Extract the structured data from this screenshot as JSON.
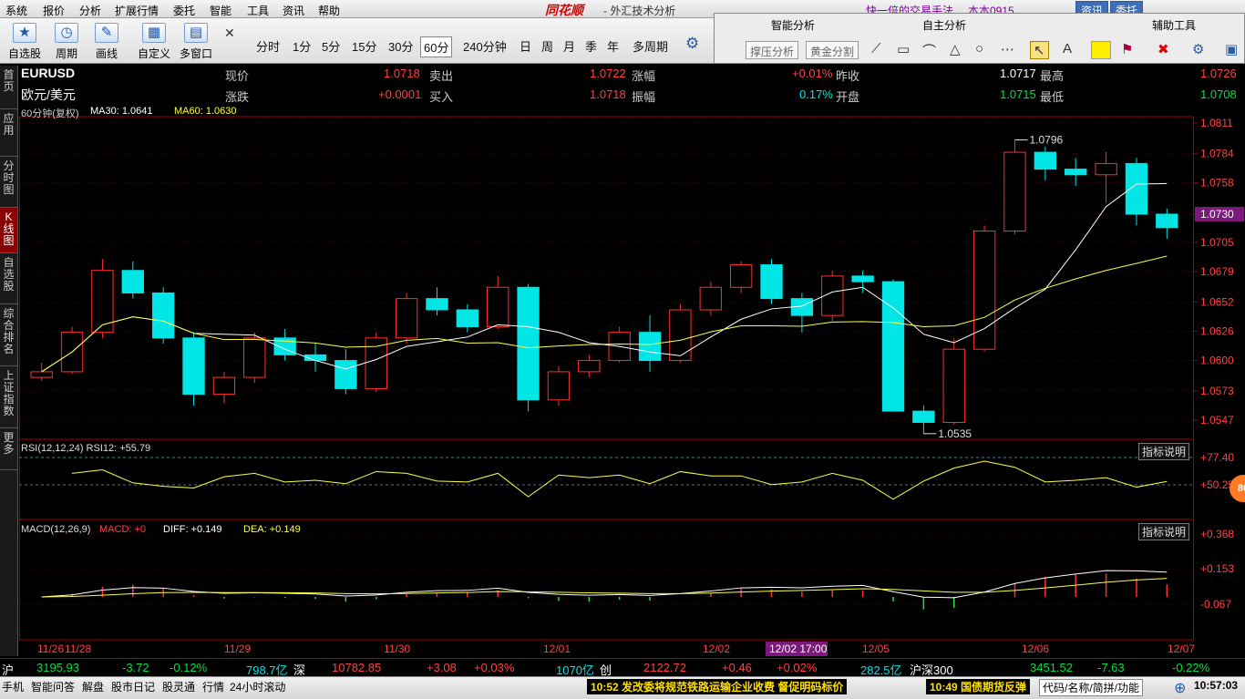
{
  "menu": [
    "系统",
    "报价",
    "分析",
    "扩展行情",
    "委托",
    "智能",
    "工具",
    "资讯",
    "帮助"
  ],
  "brand": "同花顺",
  "app_title": "- 外汇技术分析",
  "promo": "快一倍的交易手法",
  "user": "本本0915",
  "top_buttons": {
    "news": "资讯",
    "trade": "委托"
  },
  "toolbar": {
    "items": [
      "自选股",
      "周期",
      "画线",
      "自定义",
      "多窗口"
    ],
    "periods": [
      "分时",
      "1分",
      "5分",
      "15分",
      "30分",
      "60分",
      "240分钟",
      "日",
      "周",
      "月",
      "季",
      "年",
      "多周期"
    ],
    "active_period": "60分"
  },
  "panel": {
    "titles": [
      "智能分析",
      "自主分析",
      "辅助工具"
    ],
    "buttons": [
      "撑压分析",
      "黄金分割"
    ]
  },
  "side_tabs": [
    "首页",
    "应用",
    "分时图",
    "K线图",
    "自选股",
    "综合排名",
    "上证指数",
    "更多"
  ],
  "symbol": {
    "code": "EURUSD",
    "name": "欧元/美元"
  },
  "quote": {
    "row1": [
      {
        "label": "现价",
        "value": "1.0718"
      },
      {
        "label": "卖出",
        "value": "1.0722"
      },
      {
        "label": "涨幅",
        "value": "+0.01%"
      },
      {
        "label": "昨收",
        "value": "1.0717"
      },
      {
        "label": "最高",
        "value": "1.0726"
      }
    ],
    "row2": [
      {
        "label": "涨跌",
        "value": "+0.0001"
      },
      {
        "label": "买入",
        "value": "1.0718"
      },
      {
        "label": "振幅",
        "value": "0.17%"
      },
      {
        "label": "开盘",
        "value": "1.0715"
      },
      {
        "label": "最低",
        "value": "1.0708"
      }
    ]
  },
  "ma_legend": {
    "period": "60分钟(复权)",
    "ma30": "MA30: 1.0641",
    "ma60": "MA60: 1.0630"
  },
  "price_axis": [
    "1.0811",
    "1.0784",
    "1.0758",
    "1.0730",
    "1.0705",
    "1.0679",
    "1.0652",
    "1.0626",
    "1.0600",
    "1.0573",
    "1.0547"
  ],
  "current_price_tag": "1.0730",
  "annotations": {
    "high": "1.0796",
    "low": "1.0535"
  },
  "rsi": {
    "legend": "RSI(12,12,24)  RSI12: +55.79",
    "axis": [
      "+77.40",
      "+50.25"
    ],
    "help": "指标说明"
  },
  "macd": {
    "legend_name": "MACD(12,26,9)",
    "legend_macd": "MACD: +0",
    "legend_diff": "DIFF: +0.149",
    "legend_dea": "DEA: +0.149",
    "axis": [
      "+0.368",
      "+0.153",
      "-0.067"
    ],
    "help": "指标说明"
  },
  "date_axis": [
    "11/26",
    "11/28",
    "11/29",
    "11/30",
    "12/01",
    "12/02",
    "12/02 17:00",
    "12/05",
    "12/06",
    "12/07"
  ],
  "badge": "80",
  "chart_data": {
    "type": "candlestick",
    "title": "EURUSD 60分钟",
    "y_range": [
      1.053,
      1.0815
    ],
    "candles_ohlc_approx": [
      [
        1.0585,
        1.0598,
        1.0582,
        1.059
      ],
      [
        1.059,
        1.063,
        1.0588,
        1.0625
      ],
      [
        1.0625,
        1.069,
        1.062,
        1.068
      ],
      [
        1.068,
        1.0688,
        1.0655,
        1.066
      ],
      [
        1.066,
        1.0665,
        1.0615,
        1.062
      ],
      [
        1.062,
        1.0625,
        1.056,
        1.057
      ],
      [
        1.057,
        1.059,
        1.0562,
        1.0585
      ],
      [
        1.0585,
        1.0625,
        1.058,
        1.062
      ],
      [
        1.062,
        1.0628,
        1.06,
        1.0605
      ],
      [
        1.0605,
        1.0615,
        1.059,
        1.06
      ],
      [
        1.06,
        1.061,
        1.057,
        1.0575
      ],
      [
        1.0575,
        1.0625,
        1.0572,
        1.062
      ],
      [
        1.062,
        1.066,
        1.0615,
        1.0655
      ],
      [
        1.0655,
        1.0665,
        1.064,
        1.0645
      ],
      [
        1.0645,
        1.065,
        1.0625,
        1.063
      ],
      [
        1.063,
        1.0675,
        1.0628,
        1.0665
      ],
      [
        1.0665,
        1.0668,
        1.0555,
        1.0565
      ],
      [
        1.0565,
        1.0595,
        1.056,
        1.059
      ],
      [
        1.059,
        1.0605,
        1.0585,
        1.06
      ],
      [
        1.06,
        1.063,
        1.0598,
        1.0625
      ],
      [
        1.0625,
        1.064,
        1.059,
        1.06
      ],
      [
        1.06,
        1.065,
        1.0598,
        1.0645
      ],
      [
        1.0645,
        1.067,
        1.064,
        1.0665
      ],
      [
        1.0665,
        1.0688,
        1.066,
        1.0685
      ],
      [
        1.0685,
        1.069,
        1.065,
        1.0655
      ],
      [
        1.0655,
        1.066,
        1.0625,
        1.064
      ],
      [
        1.064,
        1.068,
        1.0635,
        1.0675
      ],
      [
        1.0675,
        1.068,
        1.066,
        1.067
      ],
      [
        1.067,
        1.0672,
        1.056,
        1.0555
      ],
      [
        1.0555,
        1.056,
        1.0535,
        1.0545
      ],
      [
        1.0545,
        1.062,
        1.0543,
        1.061
      ],
      [
        1.061,
        1.072,
        1.0608,
        1.0715
      ],
      [
        1.0715,
        1.0796,
        1.0712,
        1.0785
      ],
      [
        1.0785,
        1.079,
        1.076,
        1.077
      ],
      [
        1.077,
        1.078,
        1.0755,
        1.0765
      ],
      [
        1.0765,
        1.0785,
        1.074,
        1.0775
      ],
      [
        1.0775,
        1.078,
        1.072,
        1.073
      ],
      [
        1.073,
        1.0735,
        1.0708,
        1.0718
      ]
    ]
  }
}
